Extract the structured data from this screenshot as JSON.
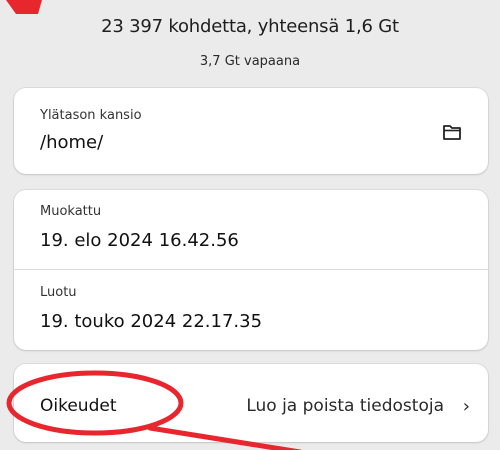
{
  "summary": {
    "items_text": "23 397 kohdetta, yhteensä 1,6 Gt",
    "free_text": "3,7 Gt vapaana"
  },
  "parent_folder": {
    "label": "Ylätason kansio",
    "value": "/home/",
    "icon": "folder-icon"
  },
  "dates": {
    "modified_label": "Muokattu",
    "modified_value": "19. elo 2024 16.42.56",
    "created_label": "Luotu",
    "created_value": "19. touko 2024 22.17.35"
  },
  "permissions": {
    "label": "Oikeudet",
    "value": "Luo ja poista tiedostoja",
    "chevron": "›"
  },
  "colors": {
    "annotation": "#e8262e",
    "card_bg": "#ffffff",
    "panel_bg": "#ebebeb"
  }
}
